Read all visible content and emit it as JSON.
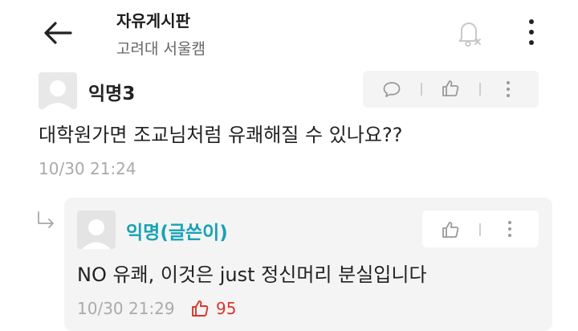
{
  "header": {
    "board_name": "자유게시판",
    "school": "고려대 서울캠",
    "icons": {
      "back": "arrow-left-icon",
      "notification": "bell-off-icon",
      "more": "more-vertical-icon"
    }
  },
  "comments": [
    {
      "author": "익명3",
      "text": "대학원가면 조교님처럼 유쾌해질 수 있나요??",
      "time": "10/30 21:24",
      "actions": [
        "reply-icon",
        "like-icon",
        "more-vertical-icon"
      ]
    }
  ],
  "replies": [
    {
      "author": "익명(글쓴이)",
      "text": "NO 유쾌, 이것은 just 정신머리 분실입니다",
      "time": "10/30 21:29",
      "likes": "95",
      "actions": [
        "like-icon",
        "more-vertical-icon"
      ]
    }
  ],
  "colors": {
    "author_highlight": "#17a2b5",
    "like_red": "#d9362b",
    "card_background": "#f4f4f4",
    "muted_text": "#aaaaaa"
  }
}
